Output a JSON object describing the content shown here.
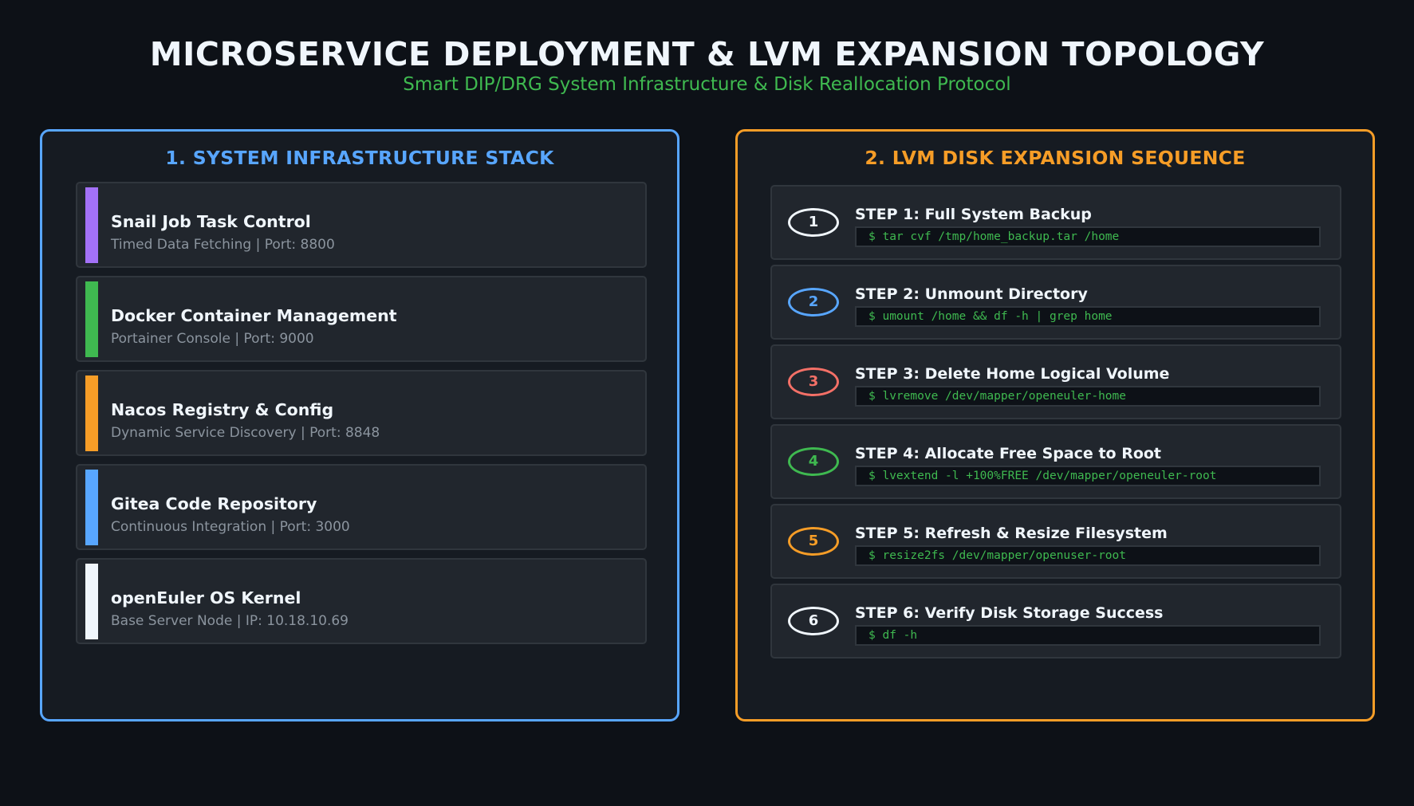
{
  "header": {
    "title": "MICROSERVICE DEPLOYMENT & LVM EXPANSION TOPOLOGY",
    "subtitle": "Smart DIP/DRG System Infrastructure & Disk Reallocation Protocol"
  },
  "colors": {
    "background": "#0d1117",
    "panel_left_accent": "#58a6ff",
    "panel_right_accent": "#f69d27",
    "command_text": "#3fb950"
  },
  "infrastructure": {
    "title": "1. SYSTEM INFRASTRUCTURE STACK",
    "items": [
      {
        "name": "Snail Job Task Control",
        "detail": "Timed Data Fetching | Port: 8800",
        "color": "#a371f7"
      },
      {
        "name": "Docker Container Management",
        "detail": "Portainer Console | Port: 9000",
        "color": "#3fb950"
      },
      {
        "name": "Nacos Registry & Config",
        "detail": "Dynamic Service Discovery | Port: 8848",
        "color": "#f69d27"
      },
      {
        "name": "Gitea Code Repository",
        "detail": "Continuous Integration | Port: 3000",
        "color": "#58a6ff"
      },
      {
        "name": "openEuler OS Kernel",
        "detail": "Base Server Node | IP: 10.18.10.69",
        "color": "#f0f6fc"
      }
    ]
  },
  "lvm": {
    "title": "2. LVM DISK EXPANSION SEQUENCE",
    "steps": [
      {
        "number": "1",
        "title": "STEP 1: Full System Backup",
        "command": "$ tar cvf /tmp/home_backup.tar /home",
        "color": "#f0f6fc"
      },
      {
        "number": "2",
        "title": "STEP 2: Unmount Directory",
        "command": "$ umount /home && df -h | grep home",
        "color": "#58a6ff"
      },
      {
        "number": "3",
        "title": "STEP 3: Delete Home Logical Volume",
        "command": "$ lvremove /dev/mapper/openeuler-home",
        "color": "#f47067"
      },
      {
        "number": "4",
        "title": "STEP 4: Allocate Free Space to Root",
        "command": "$ lvextend -l +100%FREE /dev/mapper/openeuler-root",
        "color": "#3fb950"
      },
      {
        "number": "5",
        "title": "STEP 5: Refresh & Resize Filesystem",
        "command": "$ resize2fs /dev/mapper/openuser-root",
        "color": "#f69d27"
      },
      {
        "number": "6",
        "title": "STEP 6: Verify Disk Storage Success",
        "command": "$ df -h",
        "color": "#f0f6fc"
      }
    ]
  }
}
